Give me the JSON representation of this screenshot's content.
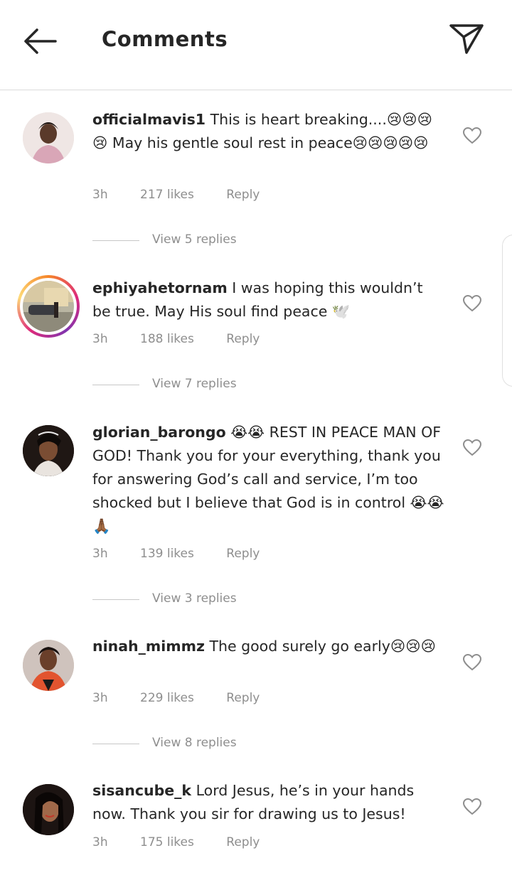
{
  "header": {
    "title": "Comments"
  },
  "comments": [
    {
      "username": "officialmavis1",
      "text": "This is heart breaking....😢😢😢😢 May his gentle soul rest in peace😢😢😢😢😢",
      "time": "3h",
      "likes": "217 likes",
      "reply": "Reply",
      "view_replies": "View 5 replies"
    },
    {
      "username": "ephiyahetornam",
      "text": "I was hoping this wouldn’t be true. May His soul find peace 🕊️",
      "time": "3h",
      "likes": "188 likes",
      "reply": "Reply",
      "view_replies": "View 7 replies"
    },
    {
      "username": "glorian_barongo",
      "text": "😭😭 REST IN PEACE MAN OF GOD! Thank you for your everything, thank you for answering God’s call and service, I’m too shocked but I believe that God is in control 😭😭🙏🏾",
      "time": "3h",
      "likes": "139 likes",
      "reply": "Reply",
      "view_replies": "View 3 replies"
    },
    {
      "username": "ninah_mimmz",
      "text": "The good surely go early😢😢😢",
      "time": "3h",
      "likes": "229 likes",
      "reply": "Reply",
      "view_replies": "View 8 replies"
    },
    {
      "username": "sisancube_k",
      "text": "Lord Jesus, he’s in your hands now. Thank you sir for drawing us to Jesus!",
      "time": "3h",
      "likes": "175 likes",
      "reply": "Reply"
    }
  ],
  "colors": {
    "text": "#262626",
    "secondary": "#8e8e8e",
    "divider": "#dbdbdb"
  },
  "icons": {
    "back": "arrow-left-icon",
    "send": "send-icon",
    "like": "heart-icon"
  }
}
